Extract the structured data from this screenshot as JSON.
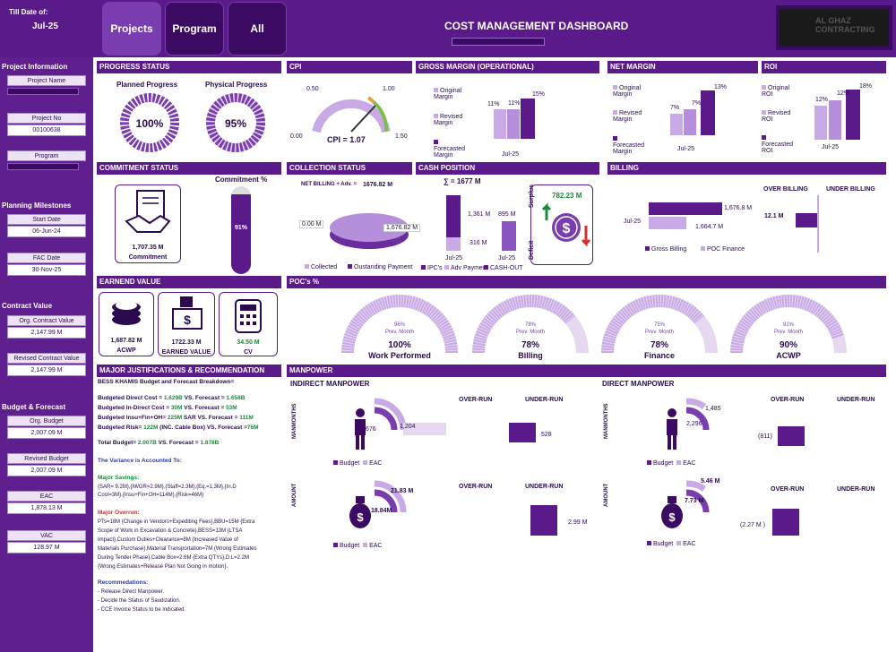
{
  "header": {
    "till_label": "Till Date of:",
    "till_value": "Jul-25",
    "title": "COST MANAGEMENT DASHBOARD",
    "tabs": [
      {
        "label": "Projects"
      },
      {
        "label": "Program"
      },
      {
        "label": "All"
      }
    ],
    "logo_text": "AL GHAZ CONTRACTING"
  },
  "sidebar": {
    "project_info": "Project Information",
    "project_name": "Project Name",
    "project_no": "Project No",
    "project_no_value": "00100638",
    "program": "Program",
    "planning": "Planning Milestones",
    "start_date": "Start Date",
    "start_value": "06-Jun-24",
    "fac_date": "FAC Date",
    "fac_value": "30-Nov-25",
    "contract": "Contract Value",
    "org_contract": "Org. Contract  Value",
    "org_contract_value": "2,147.99 M",
    "rev_contract": "Revised Contract Value",
    "rev_contract_value": "2,147.99 M",
    "budget": "Budget & Forecast",
    "org_budget": "Org. Budget",
    "org_budget_value": "2,007.09 M",
    "rev_budget": "Revised Budget",
    "rev_budget_value": "2,007.09 M",
    "eac": "EAC",
    "eac_value": "1,878.13 M",
    "vac": "VAC",
    "vac_value": "128.97 M"
  },
  "progress": {
    "title": "PROGRESS STATUS",
    "planned_label": "Planned Progress",
    "planned": "100%",
    "planned_value": 1.0,
    "physical_label": "Physical Progress",
    "physical": "95%",
    "physical_value": 0.95
  },
  "cpi": {
    "title": "CPI",
    "min": "0.00",
    "low": "0.50",
    "high": "1.00",
    "max": "1.50",
    "text": "CPI =  1.07",
    "value": 1.07
  },
  "gross_margin": {
    "title": "GROSS MARGIN (OPERATIONAL)",
    "legend": [
      "Original Margin",
      "Revised Margin",
      "Forecasted Margin"
    ],
    "values": [
      "11%",
      "11%",
      "15%"
    ],
    "x": "Jul-25"
  },
  "net_margin": {
    "title": "NET MARGIN",
    "legend": [
      "Original Margin",
      "Revised Margin",
      "Forecasted Margin"
    ],
    "values": [
      "7%",
      "7%",
      "13%"
    ],
    "x": "Jul-25"
  },
  "roi": {
    "title": "ROI",
    "legend": [
      "Original ROI",
      "Revised ROI",
      "Forecasted ROI"
    ],
    "values": [
      "12%",
      "12%",
      "18%"
    ],
    "x": "Jul-25"
  },
  "commitment": {
    "title": "COMMITMENT STATUS",
    "value": "1,707.35 M",
    "label": "Commitment",
    "pct_label": "Commitment %",
    "pct": "91%",
    "pct_value": 0.91
  },
  "collection": {
    "title": "COLLECTION STATUS",
    "net_billing": "NET BILLING + Adv. =",
    "net_value": "1676.82 M",
    "collected": "0.00 M",
    "outstanding": "1,676.82 M",
    "legend": [
      "Collected",
      "Oustanding Payment"
    ]
  },
  "cash": {
    "title": "CASH POSITION",
    "sum": "∑ = 1677 M",
    "v1": "1,361 M",
    "v2": "316 M",
    "v3": "895 M",
    "x1": "Jul-25",
    "x2": "Jul-25",
    "legend": [
      "IPC's",
      "Adv Payment",
      "CASH-OUT"
    ],
    "surplus": "Surplus",
    "deficit": "Deficit",
    "surplus_value": "782.23 M"
  },
  "billing": {
    "title": "BILLING",
    "gross": "1,676.8 M",
    "poc": "1,664.7 M",
    "y": "Jul-25",
    "legend": [
      "Gross Billing",
      "POC Finance"
    ],
    "over": "OVER BILLING",
    "under": "UNDER BILLING",
    "over_value": "12.1 M"
  },
  "earned": {
    "title": "EARNEND VALUE",
    "acwp": "1,687.82 M",
    "acwp_label": "ACWP",
    "ev": "1722.33 M",
    "ev_label": "EARNED VALUE",
    "cv": "34.50 M",
    "cv_label": "CV"
  },
  "poc": {
    "title": "POC's %",
    "gauges": [
      {
        "prev": "96%",
        "prev_label": "Prev. Month",
        "value": "100%",
        "label": "Work Performed",
        "fraction": 1.0
      },
      {
        "prev": "78%",
        "prev_label": "Prev. Month",
        "value": "78%",
        "label": "Billing",
        "fraction": 0.78
      },
      {
        "prev": "75%",
        "prev_label": "Prev. Month",
        "value": "78%",
        "label": "Finance",
        "fraction": 0.78
      },
      {
        "prev": "91%",
        "prev_label": "Prev. Month",
        "value": "90%",
        "label": "ACWP",
        "fraction": 0.9
      }
    ]
  },
  "justification": {
    "title": "MAJOR JUSTIFICATIONS & RECOMMENDATION",
    "intro": "BESS KHAMIS Budget and Forecast Breakdown=",
    "lines": [
      {
        "a": "Budgeted Direct Cost = ",
        "b": "1.629B",
        "c": " VS. Forecast = ",
        "d": "1.658B"
      },
      {
        "a": "Budgeted In-Direct Cost = ",
        "b": "30M",
        "c": " VS. Forecast = ",
        "d": "53M"
      },
      {
        "a": "Budgeted Insu+Fin+OH= ",
        "b": "225M",
        "c": " SAR VS. Forecast = ",
        "d": "111M"
      },
      {
        "a": "Budgeted Risk= ",
        "b": "122M",
        "c": " (INC. Cable Box) VS. Forecast =",
        "d": "76M"
      }
    ],
    "total_a": "Total Budget= ",
    "total_b": "2.007B",
    "total_c": " VS. Forecast = ",
    "total_d": "1.878B",
    "variance": "The Variance is Accounted To:",
    "savings_h": "Major Savings:",
    "savings_1": "{SAR= 9.2M},{IWGR=2.9M},{Staff=2.3M},{Eq.=1.3M},{In.D",
    "savings_2": "Cost=3M},{Insu+Fin+OH=114M},{Risk=46M}",
    "overrun_h": "Major Overrun:",
    "overrun": [
      "PTs=18M {Change in Vendors+Expediting Fees},BBU=15M {Extra",
      "Scope of Work in Excavation & Concrete},BESS=13M {LTSA",
      "Impact},Custom Duties+Clearance=8M {Increased Value of",
      "Materials Purchase},Material Transportation=7M {Wrong Estimates",
      "During Tender Phase},Cable Box=2.6M {Extra QTYs},D.L=2.2M",
      "{Wrong Estimates+Release Plan Not Going in motion}."
    ],
    "rec_h": "Recommedations:",
    "rec": [
      "- Release Direct Manpower.",
      "- Decide the Status of Saudization.",
      "- CCE Invoice Status to be indicated."
    ]
  },
  "manpower": {
    "title": "MANPOWER",
    "indirect": "INDIRECT MANPOWER",
    "direct": "DIRECT MANPOWER",
    "manmonths": "MANMONTHS",
    "amount": "AMOUNT",
    "over": "OVER-RUN",
    "under": "UNDER-RUN",
    "budget": "Budget",
    "eac": "EAC",
    "ind_mm_budget": "676",
    "ind_mm_eac": "1,204",
    "ind_mm_under": "528",
    "ind_amt_budget": "18.84M",
    "ind_amt_eac": "21.83 M",
    "ind_amt_under": "2.99 M",
    "dir_mm_budget": "2,296",
    "dir_mm_eac": "1,485",
    "dir_mm_over": "(811)",
    "dir_amt_budget": "7.73 M",
    "dir_amt_eac": "5.46 M",
    "dir_amt_over": "(2.27 M )"
  }
}
